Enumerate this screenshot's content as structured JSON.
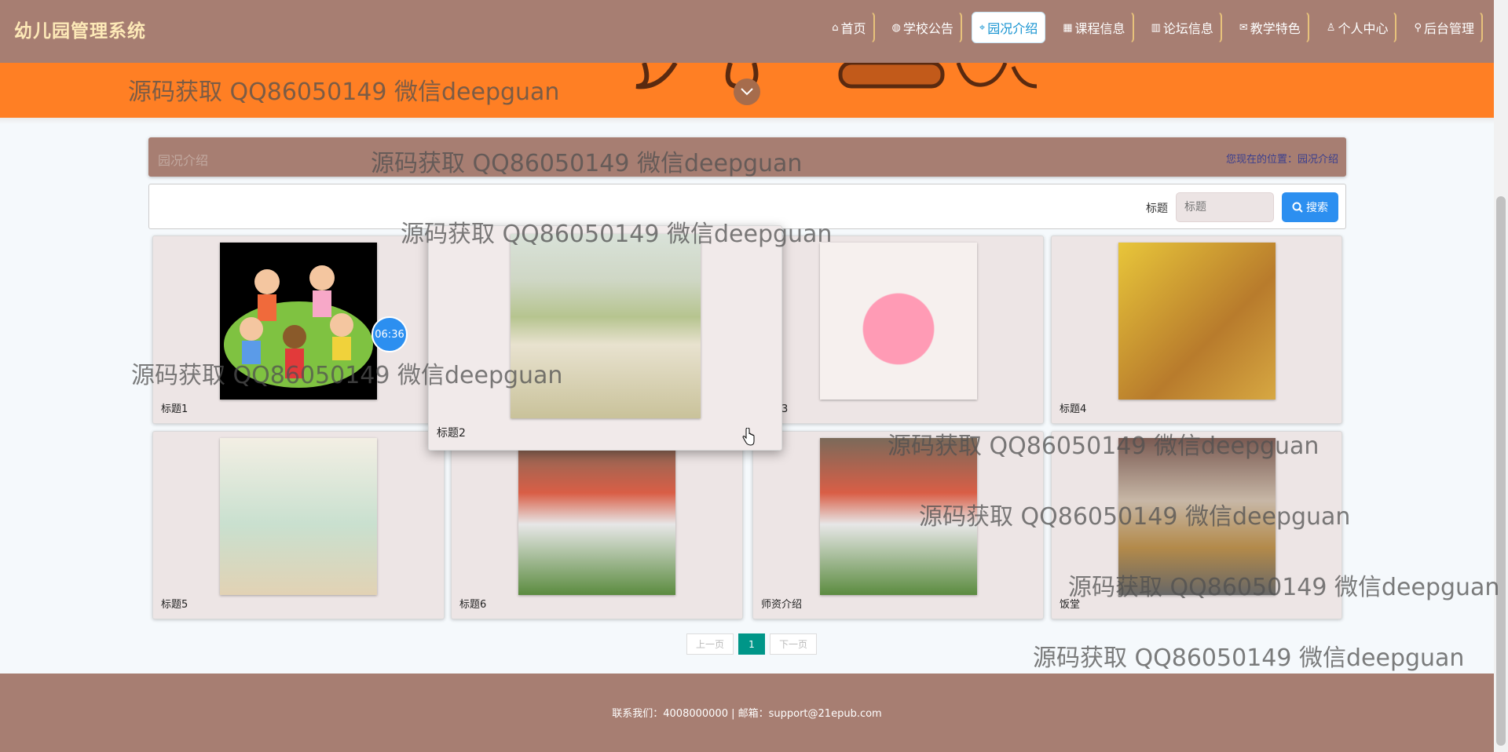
{
  "app": {
    "title": "幼儿园管理系统"
  },
  "nav": {
    "items": [
      {
        "label": "首页",
        "icon": "home-icon",
        "glyph": "⌂"
      },
      {
        "label": "学校公告",
        "icon": "globe-icon",
        "glyph": "◍"
      },
      {
        "label": "园况介绍",
        "icon": "tag-icon",
        "glyph": "⌖",
        "active": true
      },
      {
        "label": "课程信息",
        "icon": "calendar-icon",
        "glyph": "▦"
      },
      {
        "label": "论坛信息",
        "icon": "chart-icon",
        "glyph": "▥"
      },
      {
        "label": "教学特色",
        "icon": "mail-icon",
        "glyph": "✉"
      },
      {
        "label": "个人中心",
        "icon": "user-icon",
        "glyph": "♙"
      },
      {
        "label": "后台管理",
        "icon": "link-icon",
        "glyph": "⚲"
      }
    ]
  },
  "breadcrumb": {
    "title": "园况介绍",
    "location_prefix": "您现在的位置：",
    "location": "园况介绍"
  },
  "search": {
    "label": "标题",
    "placeholder": "标题",
    "button_label": "搜索"
  },
  "cards": [
    {
      "caption": "标题1"
    },
    {
      "caption": "标题2"
    },
    {
      "caption": "标题3"
    },
    {
      "caption": "标题4"
    },
    {
      "caption": "标题5"
    },
    {
      "caption": "标题6"
    },
    {
      "caption": "师资介绍"
    },
    {
      "caption": "饭堂"
    }
  ],
  "timer": {
    "value": "06:36"
  },
  "pagination": {
    "prev": "上一页",
    "current": "1",
    "next": "下一页"
  },
  "footer": {
    "contact": "联系我们：4008000000 | 邮箱：support@21epub.com"
  },
  "watermark": {
    "text": "源码获取 QQ86050149 微信deepguan"
  },
  "colors": {
    "nav": "#a77e72",
    "banner": "#ff7f24",
    "accent": "#2c8ff0",
    "pager_active": "#009688"
  }
}
